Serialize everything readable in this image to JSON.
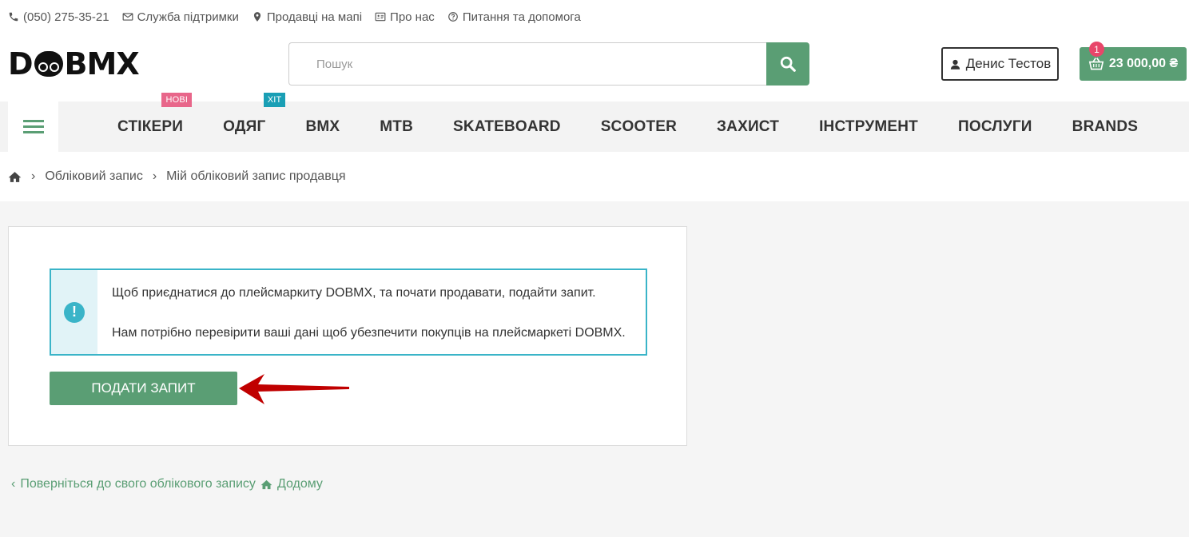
{
  "topbar": {
    "phone": "(050) 275-35-21",
    "support": "Служба підтримки",
    "sellers_map": "Продавці на мапі",
    "about": "Про нас",
    "faq": "Питання та допомога"
  },
  "header": {
    "logo_pre": "D",
    "logo_post": "BMX",
    "search_placeholder": "Пошук",
    "user_name": "Денис Тестов",
    "cart_count": "1",
    "cart_total": "23 000,00 ₴"
  },
  "nav": {
    "items": [
      {
        "label": "СТІКЕРИ",
        "tag": "НОВІ"
      },
      {
        "label": "ОДЯГ",
        "tag": "ХІТ"
      },
      {
        "label": "BMX"
      },
      {
        "label": "MTB"
      },
      {
        "label": "SKATEBOARD"
      },
      {
        "label": "SCOOTER"
      },
      {
        "label": "ЗАХИСТ"
      },
      {
        "label": "ІНСТРУМЕНТ"
      },
      {
        "label": "ПОСЛУГИ"
      },
      {
        "label": "BRANDS"
      }
    ]
  },
  "breadcrumb": {
    "account": "Обліковий запис",
    "seller_account": "Мій обліковий запис продавця"
  },
  "panel": {
    "alert_line1": "Щоб приєднатися до плейсмаркиту DOBMX, та почати продавати, подайти запит.",
    "alert_line2": "Нам потрібно перевірити ваші дані щоб убезпечити покупців на плейсмаркеті DOBMX.",
    "submit_label": "ПОДАТИ ЗАПИТ"
  },
  "footer": {
    "back_link": "Поверніться до свого облікового запису",
    "home_link": "Додому"
  },
  "colors": {
    "accent": "#5a9e74",
    "info": "#3ab4c8",
    "badge": "#e8466a",
    "arrow": "#c00000"
  }
}
